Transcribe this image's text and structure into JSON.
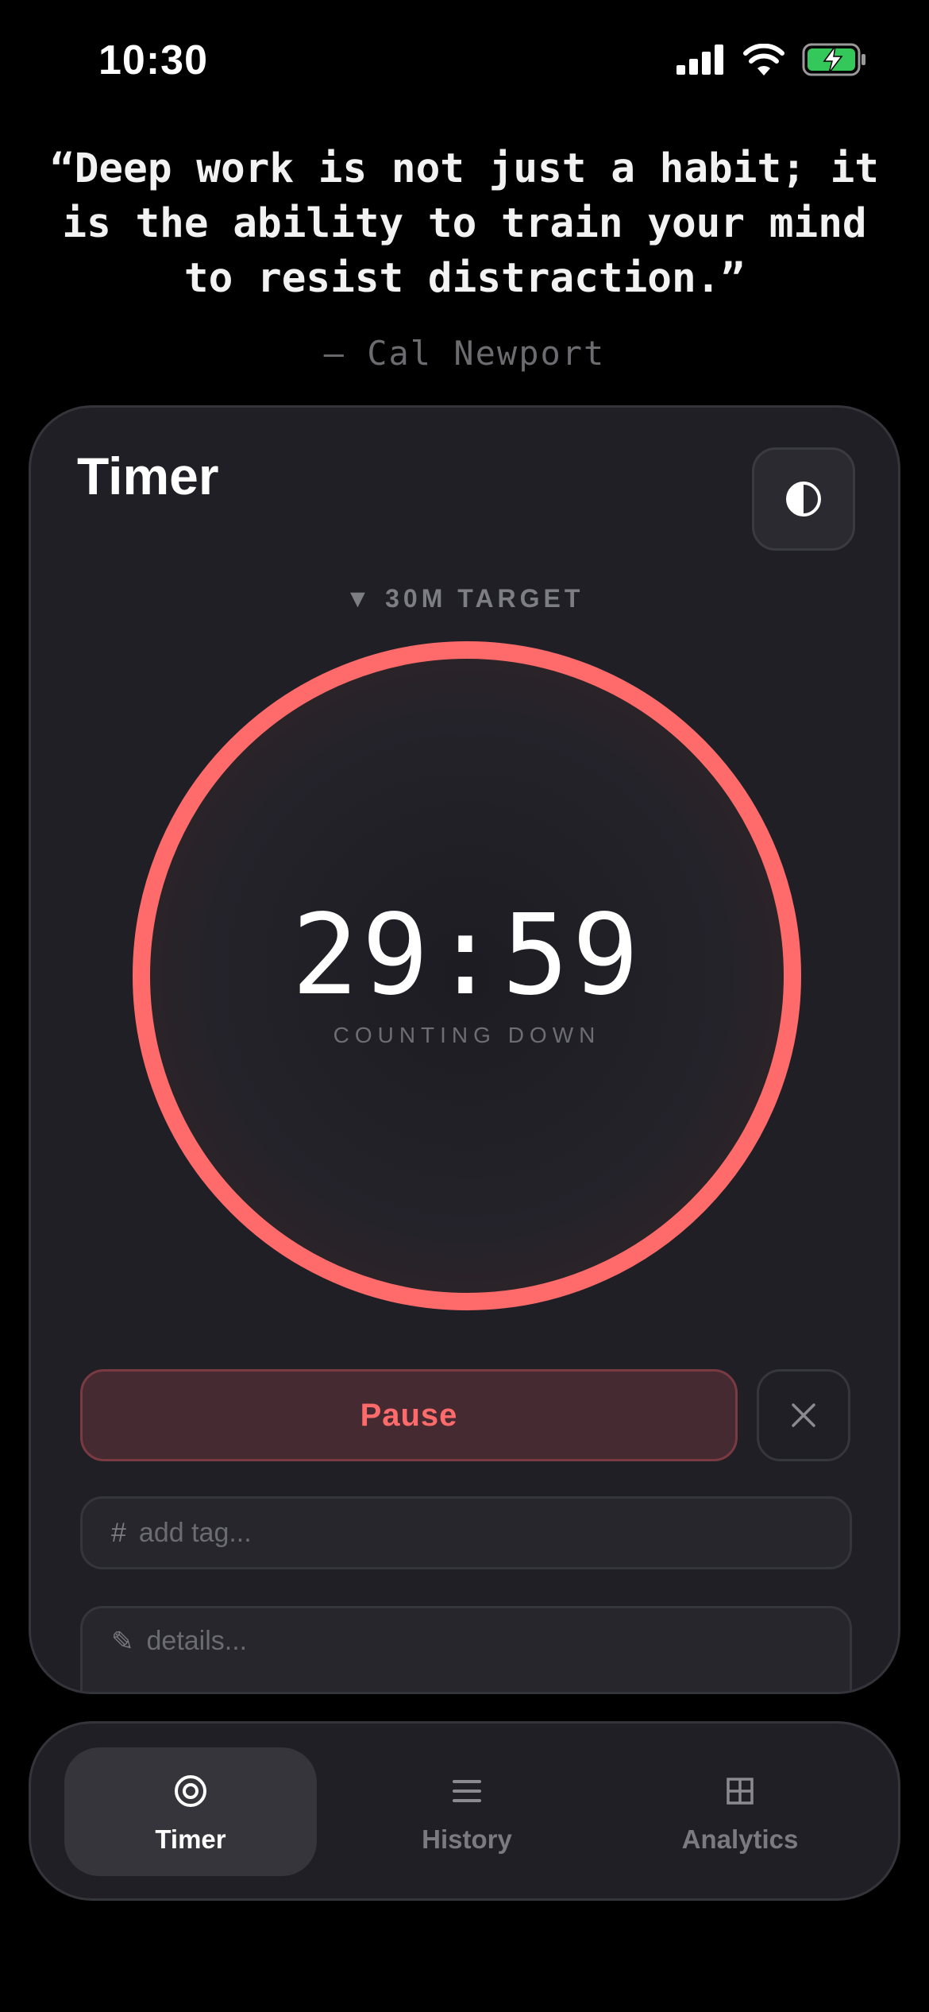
{
  "status_bar": {
    "time": "10:30"
  },
  "quote": {
    "text": "“Deep work is not just a habit; it is the ability to train your mind to resist distraction.”",
    "author": "— Cal Newport"
  },
  "timer": {
    "title": "Timer",
    "target_label": "▼ 30M TARGET",
    "time": "29:59",
    "mode": "COUNTING DOWN",
    "progress": 1.0,
    "pause_label": "Pause",
    "tag_prefix": "#",
    "tag_placeholder": "add tag...",
    "details_prefix": "✎",
    "details_placeholder": "details..."
  },
  "nav": {
    "items": [
      {
        "label": "Timer",
        "icon": "target-icon",
        "active": true
      },
      {
        "label": "History",
        "icon": "list-icon",
        "active": false
      },
      {
        "label": "Analytics",
        "icon": "grid-icon",
        "active": false
      }
    ]
  },
  "colors": {
    "accent": "#ff6b6b",
    "background": "#000000",
    "card": "#1f1f25",
    "battery": "#34c759"
  }
}
